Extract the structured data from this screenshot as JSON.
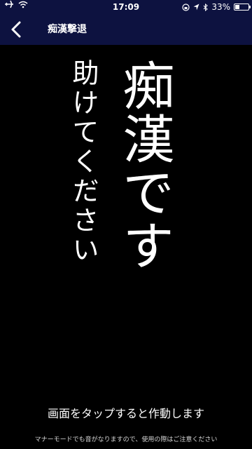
{
  "status_bar": {
    "time": "17:09",
    "battery": "33%",
    "battery_level": 0.33
  },
  "nav": {
    "title": "痴漢撃退"
  },
  "main": {
    "large_text": "痴漢です",
    "small_text": "助けてください",
    "tap_instruction": "画面をタップすると作動します",
    "footnote": "マナーモードでも音がなりますので、使用の際はご注意ください"
  }
}
